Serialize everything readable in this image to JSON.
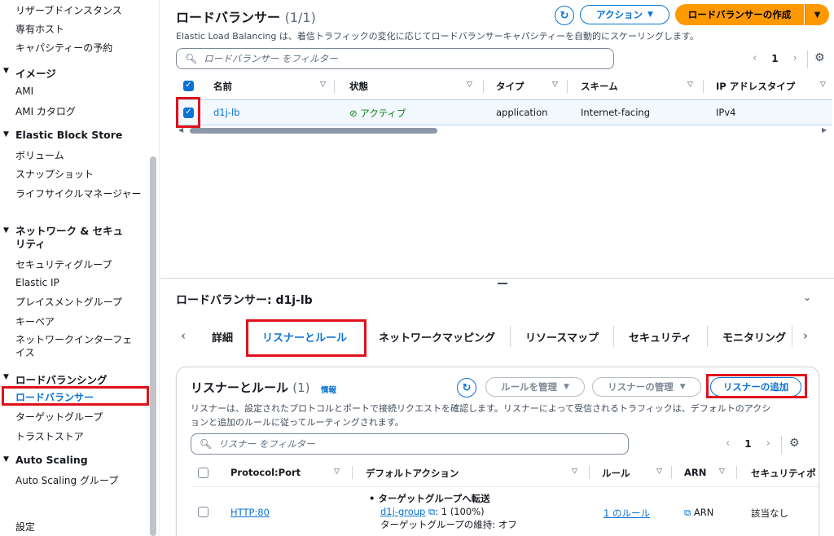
{
  "sidebar": {
    "items_top": [
      "リザーブドインスタンス",
      "専有ホスト",
      "キャパシティーの予約"
    ],
    "images": {
      "heading": "イメージ",
      "items": [
        "AMI",
        "AMI カタログ"
      ]
    },
    "ebs": {
      "heading": "Elastic Block Store",
      "items": [
        "ボリューム",
        "スナップショット",
        "ライフサイクルマネージャー"
      ]
    },
    "network": {
      "heading_line1": "ネットワーク & セキュ",
      "heading_line2": "リティ",
      "items": [
        "セキュリティグループ",
        "Elastic IP",
        "プレイスメントグループ",
        "キーペア"
      ],
      "ni_line1": "ネットワークインターフェ",
      "ni_line2": "イス"
    },
    "lb": {
      "heading": "ロードバランシング",
      "active": "ロードバランサー",
      "items": [
        "ターゲットグループ",
        "トラストストア"
      ]
    },
    "as": {
      "heading": "Auto Scaling",
      "items": [
        "Auto Scaling グループ"
      ]
    },
    "settings": "設定"
  },
  "header": {
    "title": "ロードバランサー",
    "count": "(1/1)",
    "subtitle": "Elastic Load Balancing は、着信トラフィックの変化に応じてロードバランサーキャパシティーを自動的にスケーリングします。",
    "actions_label": "アクション",
    "create_label": "ロードバランサーの作成",
    "filter_placeholder": "ロードバランサー をフィルター",
    "page": "1"
  },
  "lb_table": {
    "columns": [
      "名前",
      "状態",
      "タイプ",
      "スキーム",
      "IP アドレスタイプ"
    ],
    "rows": [
      {
        "name": "d1j-lb",
        "status": "アクティブ",
        "type": "application",
        "scheme": "Internet-facing",
        "ip_type": "IPv4"
      }
    ]
  },
  "detail": {
    "title": "ロードバランサー: d1j-lb",
    "tabs": [
      "詳細",
      "リスナーとルール",
      "ネットワークマッピング",
      "リソースマップ",
      "セキュリティ",
      "モニタリング"
    ],
    "active_tab": "リスナーとルール"
  },
  "listeners": {
    "title": "リスナーとルール",
    "count": "(1)",
    "info": "情報",
    "manage_rules": "ルールを管理",
    "manage_listener": "リスナーの管理",
    "add_listener": "リスナーの追加",
    "desc_line1": "リスナーは、設定されたプロトコルとポートで接続リクエストを確認します。リスナーによって受信されるトラフィックは、デフォルトのアクシ",
    "desc_line2": "ョンと追加のルールに従ってルーティングされます。",
    "filter_placeholder": "リスナー をフィルター",
    "page": "1",
    "columns": [
      "Protocol:Port",
      "デフォルトアクション",
      "ルール",
      "ARN",
      "セキュリティポ"
    ],
    "rows": [
      {
        "protocol": "HTTP:80",
        "action_title": "ターゲットグループへ転送",
        "target_group": "d1j-group",
        "weight": ": 1 (100%)",
        "stickiness": "ターゲットグループの維持: オフ",
        "rules": "1 のルール",
        "arn": "ARN",
        "security": "該当なし"
      }
    ]
  },
  "colors": {
    "accent": "#0972d3",
    "primary": "#ff9900",
    "success": "#037f0c",
    "highlight": "#e0111b"
  }
}
